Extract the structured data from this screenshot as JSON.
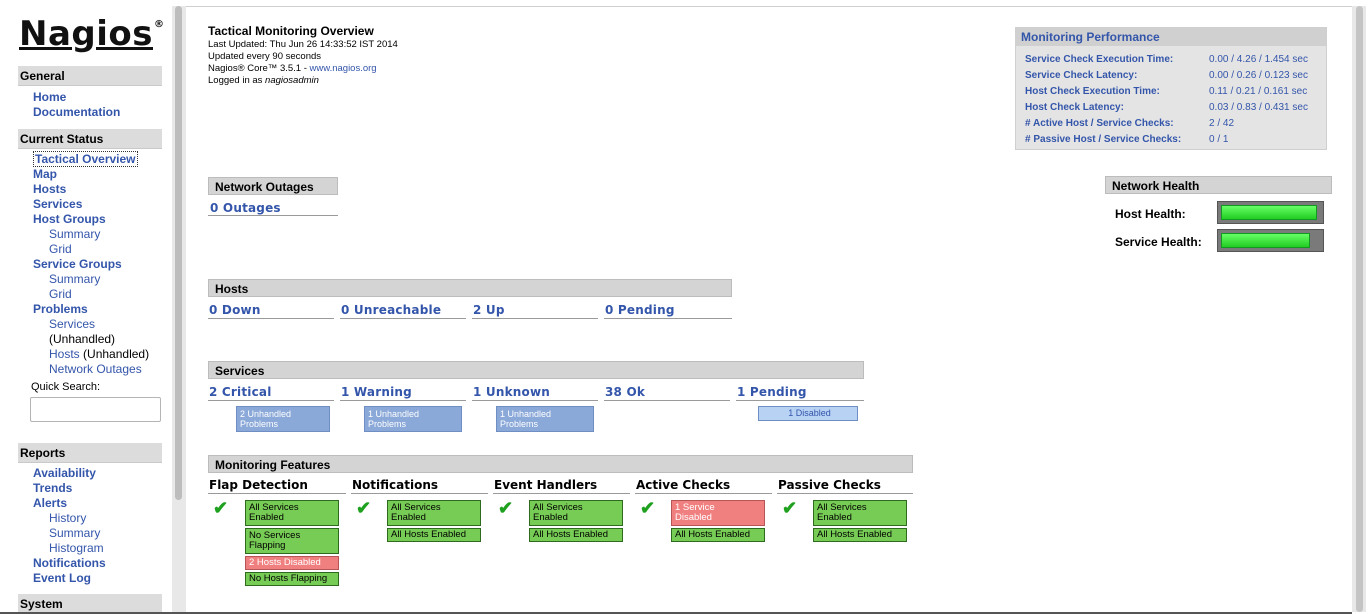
{
  "logo": {
    "text": "Nagios",
    "mark": "®"
  },
  "nav": {
    "general": {
      "title": "General",
      "links": [
        "Home",
        "Documentation"
      ]
    },
    "current_status": {
      "title": "Current Status",
      "tactical": "Tactical Overview",
      "map": "Map",
      "hosts": "Hosts",
      "services": "Services",
      "host_groups": "Host Groups",
      "hg_summary": "Summary",
      "hg_grid": "Grid",
      "service_groups": "Service Groups",
      "sg_summary": "Summary",
      "sg_grid": "Grid",
      "problems": "Problems",
      "p_services": "Services",
      "p_unhandled": "(Unhandled)",
      "p_hosts": "Hosts",
      "p_hosts_unhandled": "(Unhandled)",
      "p_outages": "Network Outages",
      "quick_search_label": "Quick Search:",
      "quick_search_value": ""
    },
    "reports": {
      "title": "Reports",
      "availability": "Availability",
      "trends": "Trends",
      "alerts": "Alerts",
      "history": "History",
      "summary": "Summary",
      "histogram": "Histogram",
      "notifications": "Notifications",
      "event_log": "Event Log"
    },
    "system": {
      "title": "System"
    }
  },
  "info": {
    "title": "Tactical Monitoring Overview",
    "last_updated": "Last Updated: Thu Jun 26 14:33:52 IST 2014",
    "update_every": "Updated every 90 seconds",
    "core_prefix": "Nagios® Core™ 3.5.1 - ",
    "core_link": "www.nagios.org",
    "logged_prefix": "Logged in as ",
    "logged_user": "nagiosadmin"
  },
  "monitoring_performance": {
    "title": "Monitoring Performance",
    "rows": [
      {
        "label": "Service Check Execution Time:",
        "value": "0.00 / 4.26 / 1.454 sec"
      },
      {
        "label": "Service Check Latency:",
        "value": "0.00 / 0.26 / 0.123 sec"
      },
      {
        "label": "Host Check Execution Time:",
        "value": "0.11 / 0.21 / 0.161 sec"
      },
      {
        "label": "Host Check Latency:",
        "value": "0.03 / 0.83 / 0.431 sec"
      },
      {
        "label": "# Active Host / Service Checks:",
        "value": "2 / 42"
      },
      {
        "label": "# Passive Host / Service Checks:",
        "value": "0 / 1"
      }
    ]
  },
  "network_outages": {
    "title": "Network Outages",
    "value": "0 Outages"
  },
  "network_health": {
    "title": "Network Health",
    "host_label": "Host Health:",
    "host_level": 0.97,
    "service_label": "Service Health:",
    "service_level": 0.9
  },
  "hosts": {
    "title": "Hosts",
    "down": "0 Down",
    "unreachable": "0 Unreachable",
    "up": "2 Up",
    "pending": "0 Pending"
  },
  "services": {
    "title": "Services",
    "critical": "2 Critical",
    "warning": "1 Warning",
    "unknown": "1 Unknown",
    "ok": "38 Ok",
    "pending": "1 Pending",
    "critical_unhandled_1": "2 Unhandled",
    "critical_unhandled_2": "Problems",
    "warning_unhandled_1": "1 Unhandled",
    "warning_unhandled_2": "Problems",
    "unknown_unhandled_1": "1 Unhandled",
    "unknown_unhandled_2": "Problems",
    "pending_disabled": "1 Disabled"
  },
  "monitoring_features": {
    "title": "Monitoring Features",
    "flap": {
      "title": "Flap Detection",
      "b1a": "All Services",
      "b1b": "Enabled",
      "b2a": "No Services",
      "b2b": "Flapping",
      "b3": "2 Hosts Disabled",
      "b4": "No Hosts Flapping"
    },
    "notifications": {
      "title": "Notifications",
      "b1a": "All Services",
      "b1b": "Enabled",
      "b2": "All Hosts Enabled"
    },
    "event_handlers": {
      "title": "Event Handlers",
      "b1a": "All Services",
      "b1b": "Enabled",
      "b2": "All Hosts Enabled"
    },
    "active_checks": {
      "title": "Active Checks",
      "b1a": "1 Service",
      "b1b": "Disabled",
      "b2": "All Hosts Enabled"
    },
    "passive_checks": {
      "title": "Passive Checks",
      "b1a": "All Services",
      "b1b": "Enabled",
      "b2": "All Hosts Enabled"
    }
  },
  "colors": {
    "link": "#3355aa",
    "ok_green": "#77cc55",
    "critical_red": "#f08080",
    "unhandled_blue": "#8aa8d8",
    "health_green": "#22dd33"
  }
}
